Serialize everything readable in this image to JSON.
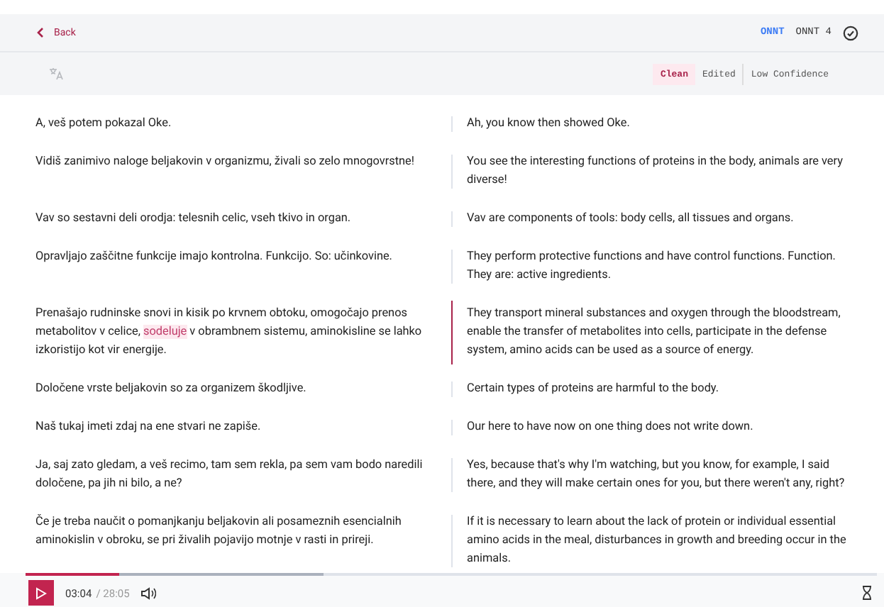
{
  "header": {
    "back": "Back",
    "mode_tag": "ONNT",
    "mode_count": "ONNT 4"
  },
  "filters": [
    {
      "label": "Clean",
      "selected": true
    },
    {
      "label": "Edited",
      "selected": false
    },
    {
      "label": "Low Confidence",
      "selected": false
    }
  ],
  "segments": [
    {
      "active": false,
      "source": [
        {
          "text": "A, veš potem pokazal Oke.",
          "highlighted": false
        }
      ],
      "translation": "Ah, you know then showed Oke."
    },
    {
      "active": false,
      "source": [
        {
          "text": "Vidiš zanimivo naloge beljakovin v organizmu, živali so zelo mnogovrstne!",
          "highlighted": false
        }
      ],
      "translation": "You see the interesting functions of proteins in the body, animals are very diverse!"
    },
    {
      "active": false,
      "source": [
        {
          "text": "Vav so sestavni deli orodja: telesnih celic, vseh tkivo in organ.",
          "highlighted": false
        }
      ],
      "translation": "Vav are components of tools: body cells, all tissues and organs."
    },
    {
      "active": false,
      "source": [
        {
          "text": "Opravljajo zaščitne funkcije imajo kontrolna. Funkcijo. So: učinkovine.",
          "highlighted": false
        }
      ],
      "translation": "They perform protective functions and have control functions. Function. They are: active ingredients."
    },
    {
      "active": true,
      "source": [
        {
          "text": "Prenašajo rudninske snovi in kisik po krvnem obtoku, omogočajo prenos metabolitov v celice, ",
          "highlighted": false
        },
        {
          "text": "sodeluje",
          "highlighted": true
        },
        {
          "text": " v obrambnem sistemu, aminokisline se lahko izkoristijo kot vir energije.",
          "highlighted": false
        }
      ],
      "translation": "They transport mineral substances and oxygen through the bloodstream, enable the transfer of metabolites into cells, participate in the defense system, amino acids can be used as a source of energy."
    },
    {
      "active": false,
      "source": [
        {
          "text": "Določene vrste beljakovin so za organizem škodljive.",
          "highlighted": false
        }
      ],
      "translation": "Certain types of proteins are harmful to the body."
    },
    {
      "active": false,
      "source": [
        {
          "text": "Naš tukaj imeti zdaj na ene stvari ne zapiše.",
          "highlighted": false
        }
      ],
      "translation": "Our here to have now on one thing does not write down."
    },
    {
      "active": false,
      "source": [
        {
          "text": "Ja, saj zato gledam, a veš recimo, tam sem rekla, pa sem vam bodo naredili določene, pa jih ni bilo, a ne?",
          "highlighted": false
        }
      ],
      "translation": "Yes, because that's why I'm watching, but you know, for example, I said there, and they will make certain ones for you, but there weren't any, right?"
    },
    {
      "active": false,
      "source": [
        {
          "text": "Če je treba naučit o pomanjkanju beljakovin ali posameznih esencialnih aminokislin v obroku, se pri živalih pojavijo motnje v rasti in prireji.",
          "highlighted": false
        }
      ],
      "translation": "If it is necessary to learn about the lack of protein or individual essential amino acids in the meal, disturbances in growth and breeding occur in the animals."
    }
  ],
  "player": {
    "level": 0.11,
    "elapsed": "03:04",
    "total": "/ 28:05"
  }
}
